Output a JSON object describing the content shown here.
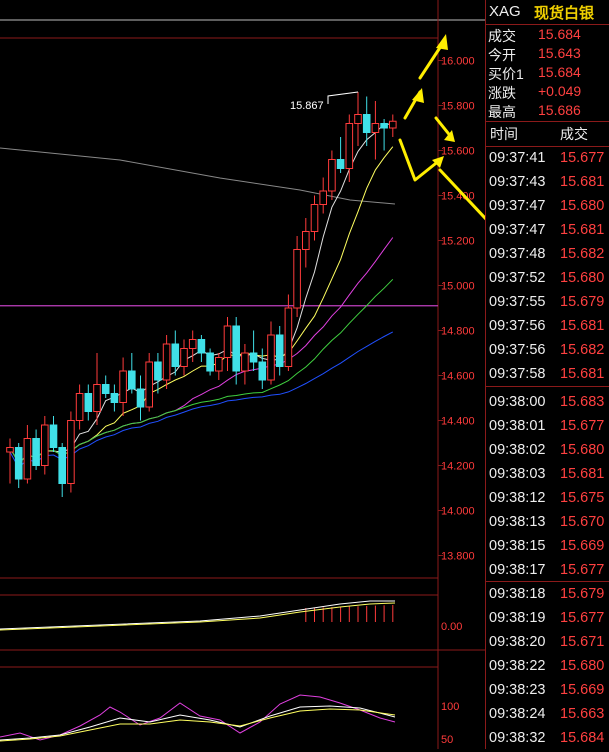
{
  "header": {
    "symbol": "XAG",
    "name": "现货白银"
  },
  "quote": [
    {
      "label": "成交",
      "value": "15.684"
    },
    {
      "label": "今开",
      "value": "15.643"
    },
    {
      "label": "买价1",
      "value": "15.684"
    },
    {
      "label": "涨跌",
      "value": "+0.049"
    },
    {
      "label": "最高",
      "value": "15.686"
    }
  ],
  "ticks_header": {
    "time": "时间",
    "price": "成交"
  },
  "ticks": [
    {
      "time": "09:37:41",
      "price": "15.677"
    },
    {
      "time": "09:37:43",
      "price": "15.681"
    },
    {
      "time": "09:37:47",
      "price": "15.680"
    },
    {
      "time": "09:37:47",
      "price": "15.681"
    },
    {
      "time": "09:37:48",
      "price": "15.682"
    },
    {
      "time": "09:37:52",
      "price": "15.680"
    },
    {
      "time": "09:37:55",
      "price": "15.679"
    },
    {
      "time": "09:37:56",
      "price": "15.681"
    },
    {
      "time": "09:37:56",
      "price": "15.682"
    },
    {
      "time": "09:37:58",
      "price": "15.681"
    },
    {
      "time": "09:38:00",
      "price": "15.683"
    },
    {
      "time": "09:38:01",
      "price": "15.677"
    },
    {
      "time": "09:38:02",
      "price": "15.680"
    },
    {
      "time": "09:38:03",
      "price": "15.681"
    },
    {
      "time": "09:38:12",
      "price": "15.675"
    },
    {
      "time": "09:38:13",
      "price": "15.670"
    },
    {
      "time": "09:38:15",
      "price": "15.669"
    },
    {
      "time": "09:38:17",
      "price": "15.677"
    },
    {
      "time": "09:38:18",
      "price": "15.679"
    },
    {
      "time": "09:38:19",
      "price": "15.677"
    },
    {
      "time": "09:38:20",
      "price": "15.671"
    },
    {
      "time": "09:38:22",
      "price": "15.680"
    },
    {
      "time": "09:38:23",
      "price": "15.669"
    },
    {
      "time": "09:38:24",
      "price": "15.663"
    },
    {
      "time": "09:38:32",
      "price": "15.684"
    }
  ],
  "colors": {
    "up": "#ff3b3b",
    "down": "#40e0e8",
    "grid": "#8b1a1a",
    "ma5": "#e0e0e0",
    "ma10": "#ffff60",
    "ma20": "#e040e0",
    "ma30": "#40d040",
    "ma60": "#2050ff",
    "ref": "#c040c0",
    "annot": "#ffee00"
  },
  "chart_data": {
    "type": "candlestick",
    "price_axis": {
      "ticks": [
        "16.000",
        "15.800",
        "15.600",
        "15.400",
        "15.200",
        "15.000",
        "14.800",
        "14.600",
        "14.400",
        "14.200",
        "14.000",
        "13.800"
      ],
      "range": [
        13.7,
        16.1
      ]
    },
    "high_label": "15.867",
    "reference_price": 14.91,
    "candles": [
      [
        14.26,
        14.32,
        14.12,
        14.28
      ],
      [
        14.28,
        14.3,
        14.1,
        14.14
      ],
      [
        14.14,
        14.38,
        14.12,
        14.32
      ],
      [
        14.32,
        14.36,
        14.18,
        14.2
      ],
      [
        14.2,
        14.42,
        14.16,
        14.38
      ],
      [
        14.38,
        14.42,
        14.26,
        14.28
      ],
      [
        14.28,
        14.3,
        14.06,
        14.12
      ],
      [
        14.12,
        14.44,
        14.08,
        14.4
      ],
      [
        14.4,
        14.56,
        14.36,
        14.52
      ],
      [
        14.52,
        14.56,
        14.4,
        14.44
      ],
      [
        14.44,
        14.7,
        14.38,
        14.56
      ],
      [
        14.56,
        14.6,
        14.5,
        14.52
      ],
      [
        14.52,
        14.56,
        14.44,
        14.48
      ],
      [
        14.48,
        14.68,
        14.42,
        14.62
      ],
      [
        14.62,
        14.7,
        14.52,
        14.54
      ],
      [
        14.54,
        14.6,
        14.4,
        14.46
      ],
      [
        14.46,
        14.7,
        14.44,
        14.66
      ],
      [
        14.66,
        14.7,
        14.52,
        14.58
      ],
      [
        14.58,
        14.78,
        14.54,
        14.74
      ],
      [
        14.74,
        14.8,
        14.6,
        14.64
      ],
      [
        14.64,
        14.76,
        14.6,
        14.72
      ],
      [
        14.72,
        14.8,
        14.66,
        14.76
      ],
      [
        14.76,
        14.78,
        14.66,
        14.7
      ],
      [
        14.7,
        14.72,
        14.6,
        14.62
      ],
      [
        14.62,
        14.7,
        14.58,
        14.68
      ],
      [
        14.68,
        14.86,
        14.62,
        14.82
      ],
      [
        14.82,
        14.86,
        14.56,
        14.62
      ],
      [
        14.62,
        14.74,
        14.56,
        14.7
      ],
      [
        14.7,
        14.8,
        14.62,
        14.66
      ],
      [
        14.66,
        14.72,
        14.54,
        14.58
      ],
      [
        14.58,
        14.84,
        14.56,
        14.78
      ],
      [
        14.78,
        14.82,
        14.6,
        14.64
      ],
      [
        14.64,
        14.96,
        14.62,
        14.9
      ],
      [
        14.9,
        15.22,
        14.86,
        15.16
      ],
      [
        15.16,
        15.3,
        15.08,
        15.24
      ],
      [
        15.24,
        15.4,
        15.2,
        15.36
      ],
      [
        15.36,
        15.48,
        15.32,
        15.42
      ],
      [
        15.42,
        15.6,
        15.38,
        15.56
      ],
      [
        15.56,
        15.66,
        15.5,
        15.52
      ],
      [
        15.52,
        15.76,
        15.46,
        15.72
      ],
      [
        15.72,
        15.86,
        15.62,
        15.76
      ],
      [
        15.76,
        15.84,
        15.62,
        15.68
      ],
      [
        15.68,
        15.82,
        15.56,
        15.72
      ],
      [
        15.72,
        15.74,
        15.6,
        15.7
      ],
      [
        15.7,
        15.76,
        15.66,
        15.73
      ]
    ],
    "macd_axis": {
      "ticks": [
        "0.00"
      ]
    },
    "kdj_axis": {
      "ticks": [
        "100",
        "50"
      ]
    }
  }
}
